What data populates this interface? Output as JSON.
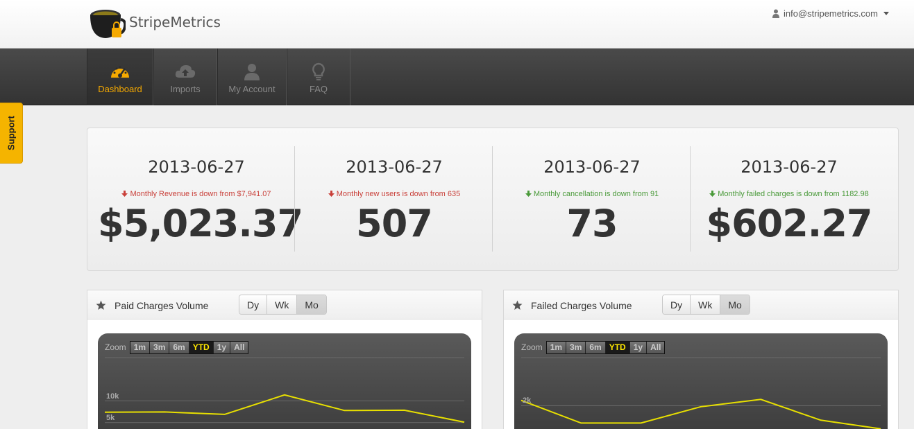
{
  "header": {
    "brand": "StripeMetrics",
    "user_email": "info@stripemetrics.com"
  },
  "nav": {
    "items": [
      {
        "label": "Dashboard",
        "icon": "gauge-icon",
        "active": true
      },
      {
        "label": "Imports",
        "icon": "cloud-upload-icon",
        "active": false
      },
      {
        "label": "My Account",
        "icon": "user-icon",
        "active": false
      },
      {
        "label": "FAQ",
        "icon": "lightbulb-icon",
        "active": false
      }
    ]
  },
  "support": {
    "label": "Support"
  },
  "stats": [
    {
      "date": "2013-06-27",
      "change": "Monthly Revenue is down from $7,941.07",
      "value": "$5,023.37",
      "tone": "bad"
    },
    {
      "date": "2013-06-27",
      "change": "Monthly new users is down from 635",
      "value": "507",
      "tone": "bad"
    },
    {
      "date": "2013-06-27",
      "change": "Monthly cancellation is down from 91",
      "value": "73",
      "tone": "good"
    },
    {
      "date": "2013-06-27",
      "change": "Monthly failed charges is down from 1182.98",
      "value": "$602.27",
      "tone": "good"
    }
  ],
  "colors": {
    "accent": "#f5a900",
    "bad": "#c9403a",
    "good": "#4a9a3a",
    "line": "#e8e000"
  },
  "widgets": [
    {
      "title": "Paid Charges Volume",
      "periods": [
        "Dy",
        "Wk",
        "Mo"
      ],
      "selected_period": "Mo",
      "zoom_label": "Zoom",
      "zoom_options": [
        "1m",
        "3m",
        "6m",
        "YTD",
        "1y",
        "All"
      ],
      "selected_zoom": "YTD"
    },
    {
      "title": "Failed Charges Volume",
      "periods": [
        "Dy",
        "Wk",
        "Mo"
      ],
      "selected_period": "Mo",
      "zoom_label": "Zoom",
      "zoom_options": [
        "1m",
        "3m",
        "6m",
        "YTD",
        "1y",
        "All"
      ],
      "selected_zoom": "YTD"
    }
  ],
  "chart_data": [
    {
      "type": "line",
      "y_ticks": [
        "10k",
        "5k"
      ],
      "y_tick_values": [
        10000,
        5000
      ],
      "ylim": [
        0,
        20000
      ],
      "series": [
        {
          "values": [
            7400,
            7450,
            6900,
            11400,
            7800,
            7850,
            5100
          ]
        }
      ]
    },
    {
      "type": "line",
      "y_ticks": [
        "2k"
      ],
      "y_tick_values": [
        2000
      ],
      "ylim": [
        0,
        4500
      ],
      "series": [
        {
          "values": [
            2280,
            1100,
            1100,
            1950,
            2330,
            1250,
            800
          ]
        }
      ]
    }
  ]
}
